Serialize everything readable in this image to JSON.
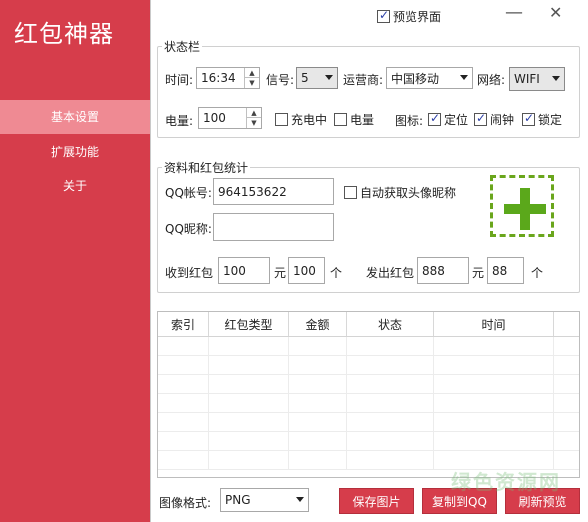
{
  "app": {
    "title": "红包神器"
  },
  "sidebar": {
    "items": [
      {
        "label": "基本设置",
        "active": true
      },
      {
        "label": "扩展功能",
        "active": false
      },
      {
        "label": "关于",
        "active": false
      }
    ]
  },
  "window": {
    "preview_label": "预览界面",
    "preview_checked": true
  },
  "status_bar": {
    "legend": "状态栏",
    "time_label": "时间:",
    "time_value": "16:34",
    "signal_label": "信号:",
    "signal_value": "5",
    "carrier_label": "运营商:",
    "carrier_value": "中国移动",
    "network_label": "网络:",
    "network_value": "WIFI",
    "battery_label": "电量:",
    "battery_value": "100",
    "charging_label": "充电中",
    "charging_checked": false,
    "battery_chk_label": "电量",
    "battery_chk_checked": false,
    "icons_label": "图标:",
    "location_label": "定位",
    "location_checked": true,
    "alarm_label": "闹钟",
    "alarm_checked": true,
    "lock_label": "锁定",
    "lock_checked": true
  },
  "profile": {
    "legend": "资料和红包统计",
    "qq_label": "QQ帐号:",
    "qq_value": "964153622",
    "auto_label": "自动获取头像昵称",
    "auto_checked": false,
    "nick_label": "QQ昵称:",
    "nick_value": "",
    "received_label": "收到红包",
    "received_amount": "100",
    "received_yuan": "元",
    "received_count": "100",
    "received_unit": "个",
    "sent_label": "发出红包",
    "sent_amount": "888",
    "sent_yuan": "元",
    "sent_count": "88",
    "sent_unit": "个"
  },
  "table": {
    "columns": [
      "索引",
      "红包类型",
      "金额",
      "状态",
      "时间"
    ]
  },
  "footer": {
    "format_label": "图像格式:",
    "format_value": "PNG",
    "save_label": "保存图片",
    "copy_label": "复制到QQ",
    "refresh_label": "刷新预览"
  },
  "watermark": "绿色资源网",
  "colors": {
    "accent": "#d63d4b",
    "sidebar_active": "#ef8a93",
    "add_green": "#5ba81b"
  }
}
